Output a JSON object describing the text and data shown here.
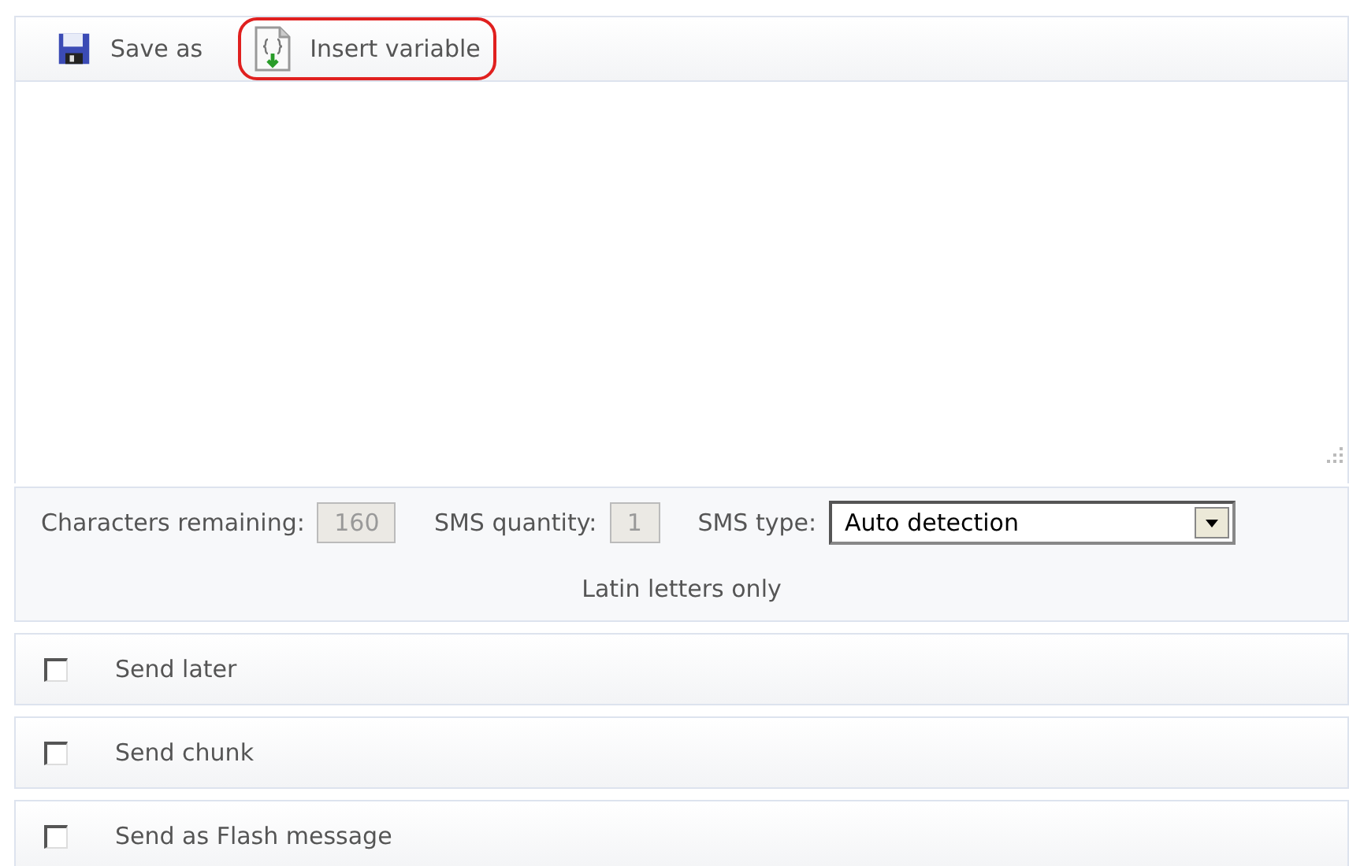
{
  "toolbar": [
    {
      "kind": "save",
      "label": "Save as",
      "highlighted": false
    },
    {
      "kind": "variable",
      "label": "Insert variable",
      "highlighted": true
    }
  ],
  "stats": {
    "characters_label": "Characters remaining:",
    "characters_value": "160",
    "quantity_label": "SMS quantity:",
    "quantity_value": "1",
    "type_label": "SMS type:",
    "type_value": "Auto detection",
    "note": "Latin letters only"
  },
  "options": [
    {
      "label": "Send later",
      "checked": false
    },
    {
      "label": "Send chunk",
      "checked": false
    },
    {
      "label": "Send as Flash message",
      "checked": false
    }
  ]
}
